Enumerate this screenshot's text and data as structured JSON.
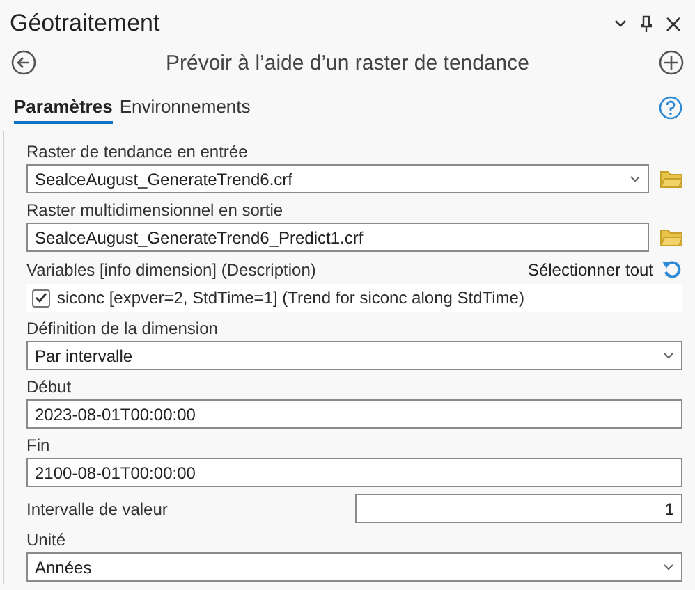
{
  "pane": {
    "title": "Géotraitement"
  },
  "tool": {
    "title": "Prévoir à l’aide d’un raster de tendance"
  },
  "tabs": [
    {
      "label": "Paramètres",
      "selected": true
    },
    {
      "label": "Environnements",
      "selected": false
    }
  ],
  "parameters": [
    {
      "kind": "dropdown",
      "label": "Raster de tendance en entrée",
      "value": "SealceAugust_GenerateTrend6.crf",
      "browse": true
    },
    {
      "kind": "text",
      "label": "Raster multidimensionnel en sortie",
      "value": "SealceAugust_GenerateTrend6_Predict1.crf",
      "browse": true
    },
    {
      "kind": "checklist",
      "label": "Variables [info dimension] (Description)",
      "action": "Sélectionner tout",
      "items": [
        {
          "label": "siconc [expver=2, StdTime=1] (Trend for siconc along StdTime)",
          "checked": true
        }
      ]
    },
    {
      "kind": "dropdown",
      "label": "Définition de la dimension",
      "value": "Par intervalle",
      "browse": false
    },
    {
      "kind": "text",
      "label": "Début",
      "value": "2023-08-01T00:00:00",
      "browse": false
    },
    {
      "kind": "text",
      "label": "Fin",
      "value": "2100-08-01T00:00:00",
      "browse": false
    },
    {
      "kind": "inline",
      "label": "Intervalle de valeur",
      "value": "1"
    },
    {
      "kind": "dropdown",
      "label": "Unité",
      "value": "Années",
      "browse": false
    }
  ]
}
